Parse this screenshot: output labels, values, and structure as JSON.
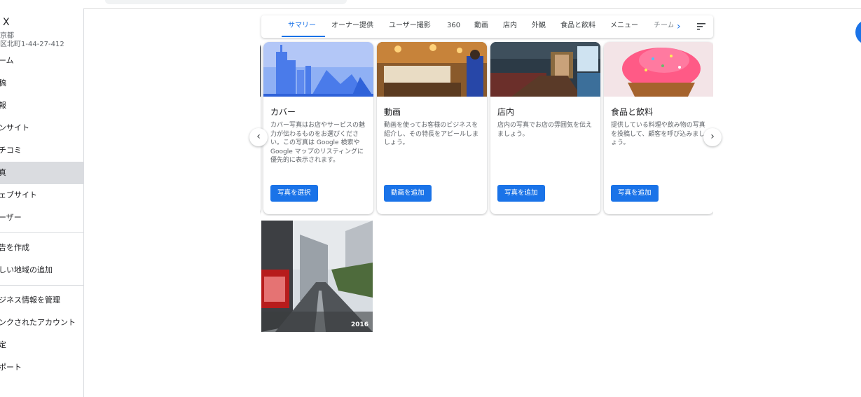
{
  "sidebar": {
    "business_name": "X",
    "address_line1": "京都",
    "address_line2": "区北町1-44-27-412",
    "items": [
      {
        "label": "ーム"
      },
      {
        "label": "稿"
      },
      {
        "label": "報"
      },
      {
        "label": "ンサイト"
      },
      {
        "label": "チコミ"
      },
      {
        "label": "真",
        "active": true
      },
      {
        "label": "ェブサイト"
      },
      {
        "label": "ーザー"
      }
    ],
    "items2": [
      {
        "label": "告を作成"
      },
      {
        "label": "しい地域の追加"
      }
    ],
    "items3": [
      {
        "label": "ジネス情報を管理"
      },
      {
        "label": "ンクされたアカウント"
      },
      {
        "label": "定"
      },
      {
        "label": "ポート"
      }
    ]
  },
  "tabs": [
    {
      "label": "サマリー",
      "active": true
    },
    {
      "label": "オーナー提供"
    },
    {
      "label": "ユーザー撮影"
    },
    {
      "label": "360"
    },
    {
      "label": "動画"
    },
    {
      "label": "店内"
    },
    {
      "label": "外観"
    },
    {
      "label": "食品と飲料"
    },
    {
      "label": "メニュー"
    },
    {
      "label": "チーム"
    }
  ],
  "cards": [
    {
      "title": "カバー",
      "desc": "カバー写真はお店やサービスの魅力が伝わるものをお選びください。この写真は Google 検索や Google マップのリスティングに優先的に表示されます。",
      "button": "写真を選択"
    },
    {
      "title": "動画",
      "desc": "動画を使ってお客様のビジネスを紹介し、その特長をアピールしましょう。",
      "button": "動画を追加"
    },
    {
      "title": "店内",
      "desc": "店内の写真でお店の雰囲気を伝えましょう。",
      "button": "写真を追加"
    },
    {
      "title": "食品と飲料",
      "desc": "提供している料理や飲み物の写真を投稿して、顧客を呼び込みましょう。",
      "button": "写真を追加"
    }
  ],
  "street_photo": {
    "year": "2016"
  },
  "colors": {
    "accent": "#1a73e8",
    "active_nav": "#dadce0"
  }
}
